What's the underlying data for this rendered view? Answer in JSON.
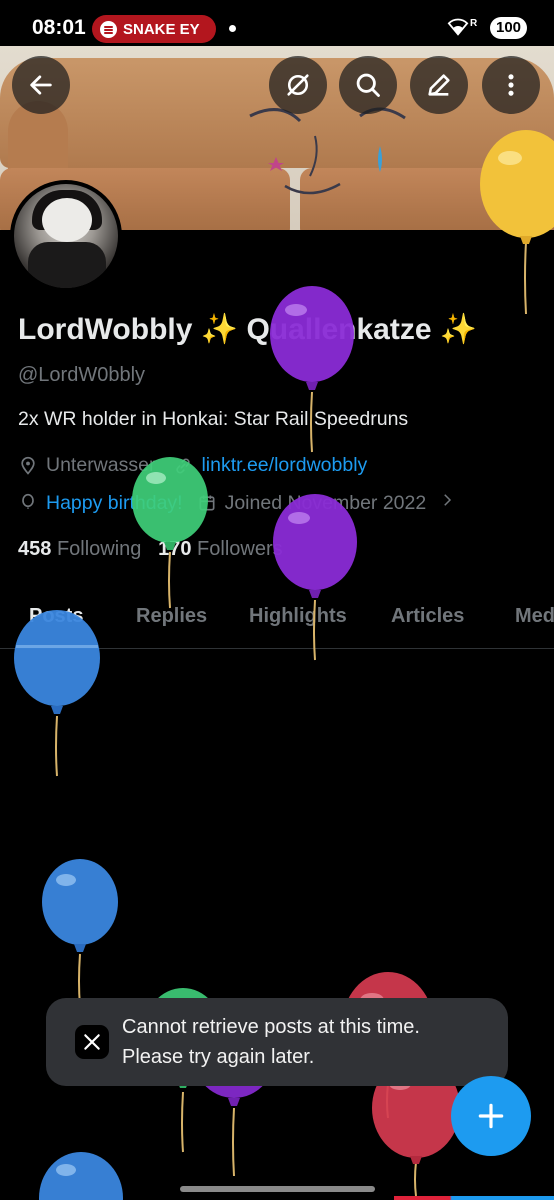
{
  "status_bar": {
    "time": "08:01",
    "now_playing": "SNAKE EY",
    "battery": "100",
    "signal_label": "R"
  },
  "header": {
    "back": "back-arrow-icon",
    "buttons": [
      "grok-icon",
      "search-icon",
      "edit-icon",
      "more-icon"
    ]
  },
  "profile": {
    "name": "LordWobbly ✨ Quallenkatze ✨",
    "handle": "@LordW0bbly",
    "bio": "2x WR holder in Honkai: Star Rail Speedruns",
    "location": "Unterwasser",
    "link": "linktr.ee/lordwobbly",
    "birthday": "Happy birthday!",
    "joined": "Joined November 2022",
    "following_count": "458",
    "following_label": "Following",
    "followers_count": "170",
    "followers_label": "Followers"
  },
  "tabs": [
    "Posts",
    "Replies",
    "Highlights",
    "Articles",
    "Media"
  ],
  "toast": {
    "line1": "Cannot retrieve posts at this time.",
    "line2": "Please try again later."
  },
  "colors": {
    "accent": "#1d9bf0",
    "background": "#000000",
    "muted_text": "#71767b",
    "spotify_pill": "#b3161e",
    "balloon_yellow": "#f2c23a",
    "balloon_purple": "#8a2bd6",
    "balloon_green": "#3fcf7a",
    "balloon_blue": "#3a86de",
    "balloon_red": "#d63b50"
  }
}
